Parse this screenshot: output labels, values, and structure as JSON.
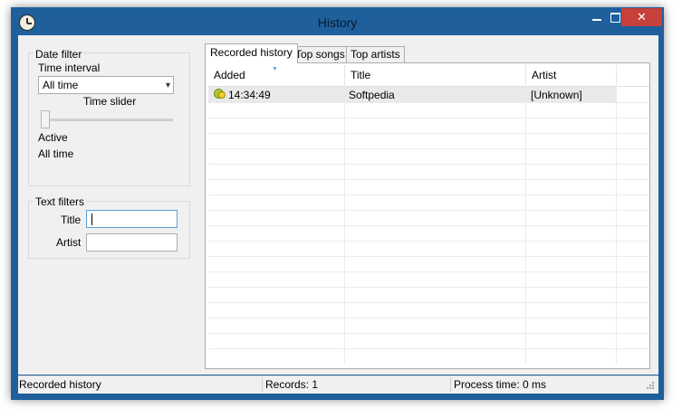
{
  "window": {
    "title": "History"
  },
  "date_filter": {
    "group_title": "Date filter",
    "time_interval_label": "Time interval",
    "time_interval_value": "All time",
    "time_slider_label": "Time slider",
    "active_label": "Active",
    "active_value": "All time"
  },
  "text_filters": {
    "group_title": "Text filters",
    "title_label": "Title",
    "title_value": "",
    "artist_label": "Artist",
    "artist_value": ""
  },
  "tabs": [
    {
      "label": "Recorded history",
      "selected": true
    },
    {
      "label": "Top songs",
      "selected": false
    },
    {
      "label": "Top artists",
      "selected": false
    }
  ],
  "table": {
    "columns": [
      "Added",
      "Title",
      "Artist"
    ],
    "rows": [
      {
        "added": "14:34:49",
        "title": "Softpedia",
        "artist": "[Unknown]"
      }
    ]
  },
  "status": {
    "view": "Recorded history",
    "records": "Records: 1",
    "process_time": "Process time: 0 ms"
  },
  "colors": {
    "frame": "#1e5f9c",
    "close_button": "#c7403a"
  }
}
